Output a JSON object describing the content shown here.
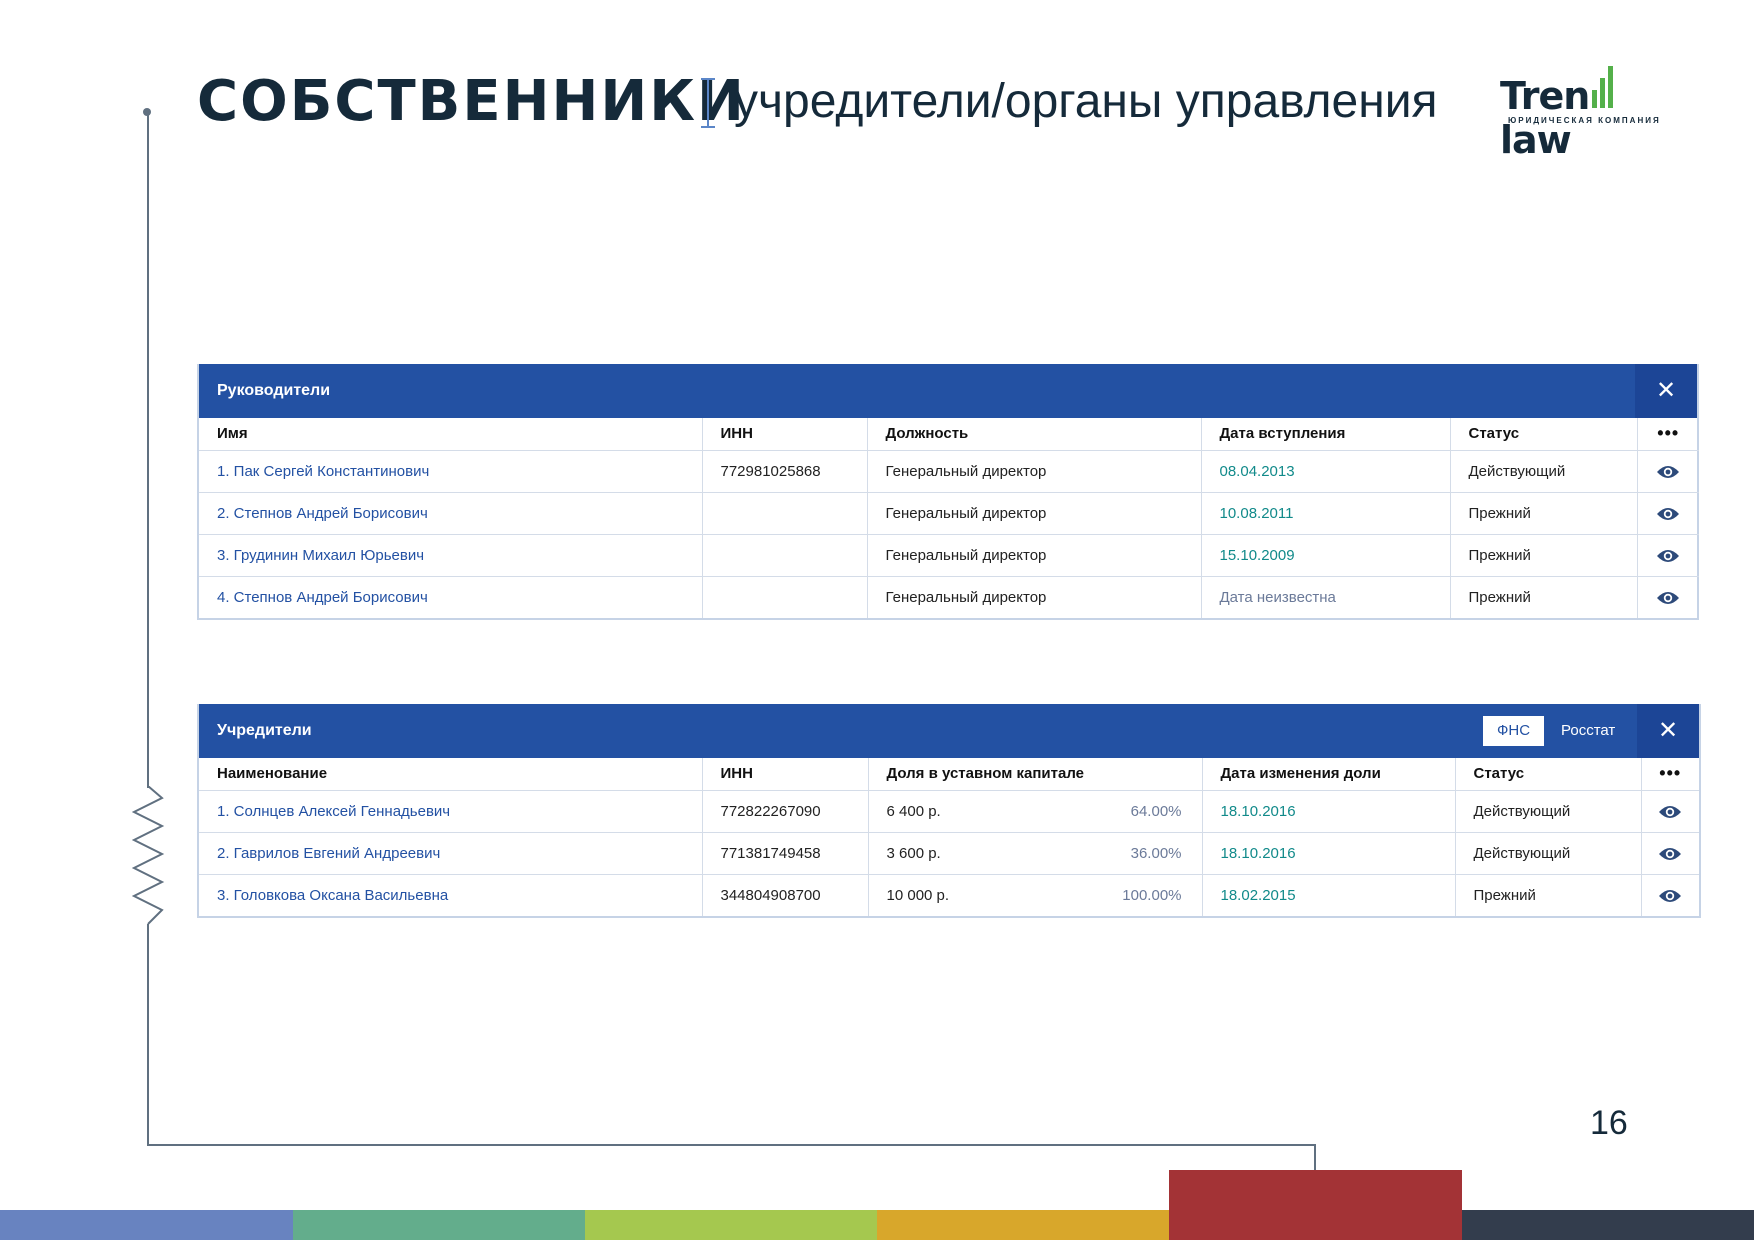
{
  "header": {
    "title": "СОБСТВЕННИКИ",
    "subtitle": "учредители/органы управления"
  },
  "logo": {
    "word_start": "Tren",
    "word_end": "law",
    "tagline": "ЮРИДИЧЕСКАЯ КОМПАНИЯ",
    "brand_green": "#54b04a"
  },
  "page_number": "16",
  "colors": {
    "panel_header": "#2351a3",
    "link": "#2351a3",
    "date": "#118a8a",
    "stripes": [
      "#6883c0",
      "#63ad8c",
      "#a5c84f",
      "#d8a72b",
      "#a33336",
      "#333d4d"
    ]
  },
  "managers": {
    "title": "Руководители",
    "close_icon": "close-icon",
    "columns": [
      "Имя",
      "ИНН",
      "Должность",
      "Дата вступления",
      "Статус",
      "•••"
    ],
    "rows": [
      {
        "name": "1. Пак Сергей Константинович",
        "inn": "772981025868",
        "position": "Генеральный директор",
        "date": "08.04.2013",
        "status": "Действующий"
      },
      {
        "name": "2. Степнов Андрей Борисович",
        "inn": "",
        "position": "Генеральный директор",
        "date": "10.08.2011",
        "status": "Прежний"
      },
      {
        "name": "3. Грудинин Михаил Юрьевич",
        "inn": "",
        "position": "Генеральный директор",
        "date": "15.10.2009",
        "status": "Прежний"
      },
      {
        "name": "4. Степнов Андрей Борисович",
        "inn": "",
        "position": "Генеральный директор",
        "date": "Дата неизвестна",
        "status": "Прежний"
      }
    ]
  },
  "founders": {
    "title": "Учредители",
    "tabs": [
      "ФНС",
      "Росстат"
    ],
    "active_tab": "ФНС",
    "columns": [
      "Наименование",
      "ИНН",
      "Доля в уставном капитале",
      "Дата изменения доли",
      "Статус",
      "•••"
    ],
    "rows": [
      {
        "name": "1. Солнцев Алексей Геннадьевич",
        "inn": "772822267090",
        "share_amount": "6 400 р.",
        "share_pct": "64.00%",
        "date": "18.10.2016",
        "status": "Действующий"
      },
      {
        "name": "2. Гаврилов Евгений Андреевич",
        "inn": "771381749458",
        "share_amount": "3 600 р.",
        "share_pct": "36.00%",
        "date": "18.10.2016",
        "status": "Действующий"
      },
      {
        "name": "3. Головкова Оксана Васильевна",
        "inn": "344804908700",
        "share_amount": "10 000 р.",
        "share_pct": "100.00%",
        "date": "18.02.2015",
        "status": "Прежний"
      }
    ]
  }
}
